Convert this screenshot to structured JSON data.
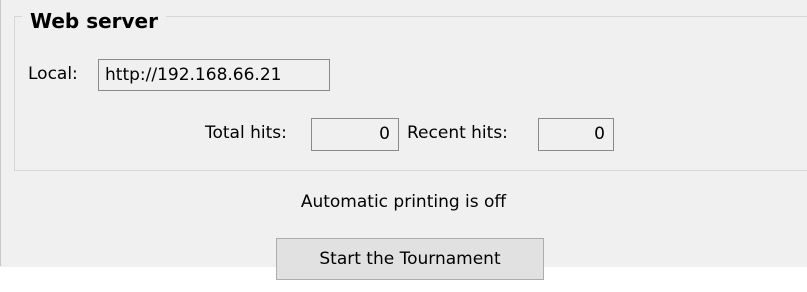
{
  "web_server": {
    "title": "Web server",
    "local_label": "Local:",
    "local_value": "http://192.168.66.21",
    "total_hits_label": "Total hits:",
    "total_hits_value": "0",
    "recent_hits_label": "Recent hits:",
    "recent_hits_value": "0"
  },
  "status": {
    "printing_text": "Automatic printing is off"
  },
  "actions": {
    "start_label": "Start the Tournament"
  }
}
